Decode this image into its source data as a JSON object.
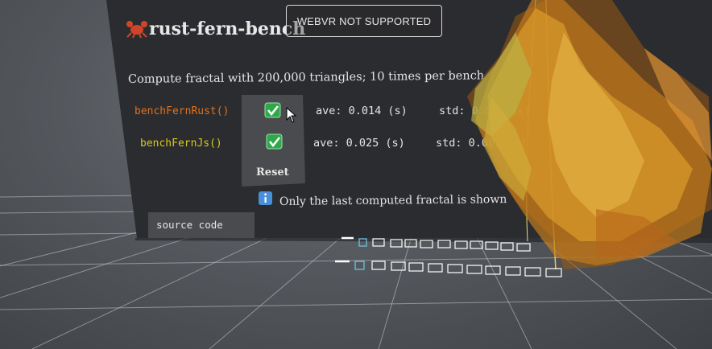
{
  "title": "rust-fern-bench",
  "title_icon": "crab-icon",
  "webvr_label": "WEBVR NOT SUPPORTED",
  "description": "Compute fractal with 200,000 triangles; 10 times per bench",
  "benches": [
    {
      "name": "benchFernRust()",
      "checked": true,
      "ave": "ave: 0.014 (s)",
      "std": "std: 0.001 (s)",
      "color": "#e0701e"
    },
    {
      "name": "benchFernJs()",
      "checked": true,
      "ave": "ave: 0.025 (s)",
      "std": "std: 0.001 (s)",
      "color": "#d9c81f"
    }
  ],
  "reset_label": "Reset",
  "info_icon": "info-icon",
  "info_text": "Only the last computed fractal is shown",
  "source_code_label": "source code",
  "colors": {
    "accent_rust": "#e0701e",
    "accent_js": "#d9c81f",
    "panel": "#2d2e31",
    "button": "#4c4d50",
    "check": "#2fa84a"
  }
}
